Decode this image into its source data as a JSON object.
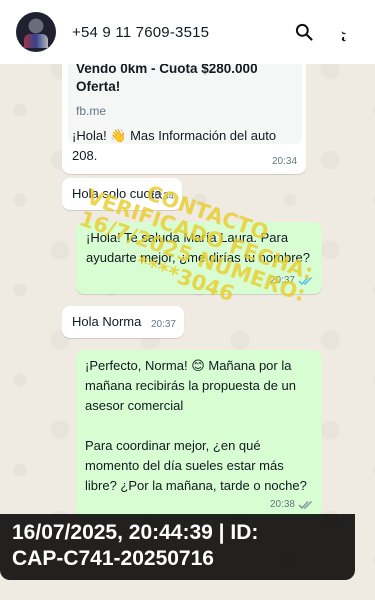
{
  "header": {
    "contact": "+54 9 11 7609-3515",
    "icons": [
      "search-icon",
      "more-vert-icon"
    ]
  },
  "messages": [
    {
      "id": "preview",
      "direction": "incoming",
      "preview_title": "Vendo 0km - Cuota $280.000 Oferta!",
      "preview_domain": "fb.me",
      "text": "¡Hola! 👋 Mas Información del auto 208.",
      "time": "20:34"
    },
    {
      "id": "m2",
      "direction": "incoming",
      "text": "Hola solo cuota",
      "time": "20:34"
    },
    {
      "id": "m3",
      "direction": "outgoing",
      "text": "¡Hola! Te saluda María Laura. Para ayudarte mejor, ¿me dirías tu nombre?",
      "time": "20:37",
      "status": "read"
    },
    {
      "id": "m4",
      "direction": "incoming",
      "text": "Hola Norma",
      "time": "20:37"
    },
    {
      "id": "m5",
      "direction": "outgoing",
      "text_p1": "¡Perfecto, Norma! 😊 Mañana por la mañana recibirás la propuesta de un asesor comercial",
      "text_p2": "Para coordinar mejor, ¿en qué momento del día sueles estar más libre? ¿Por la mañana, tarde o noche?",
      "time": "20:38",
      "status": "delivered"
    }
  ],
  "watermark": "CONTACTO VERIFICADO FECHA: 16/7/2025 NÚMERO: ****3046",
  "overlay": {
    "text": "16/07/2025, 20:44:39 | ID:\nCAP-C741-20250716",
    "mic_icon": "mic-icon"
  },
  "colors": {
    "chat_bg": "#efeae2",
    "incoming": "#ffffff",
    "outgoing": "#d9fdd3",
    "read_ticks": "#53bdeb",
    "watermark": "#e8cd2d"
  }
}
